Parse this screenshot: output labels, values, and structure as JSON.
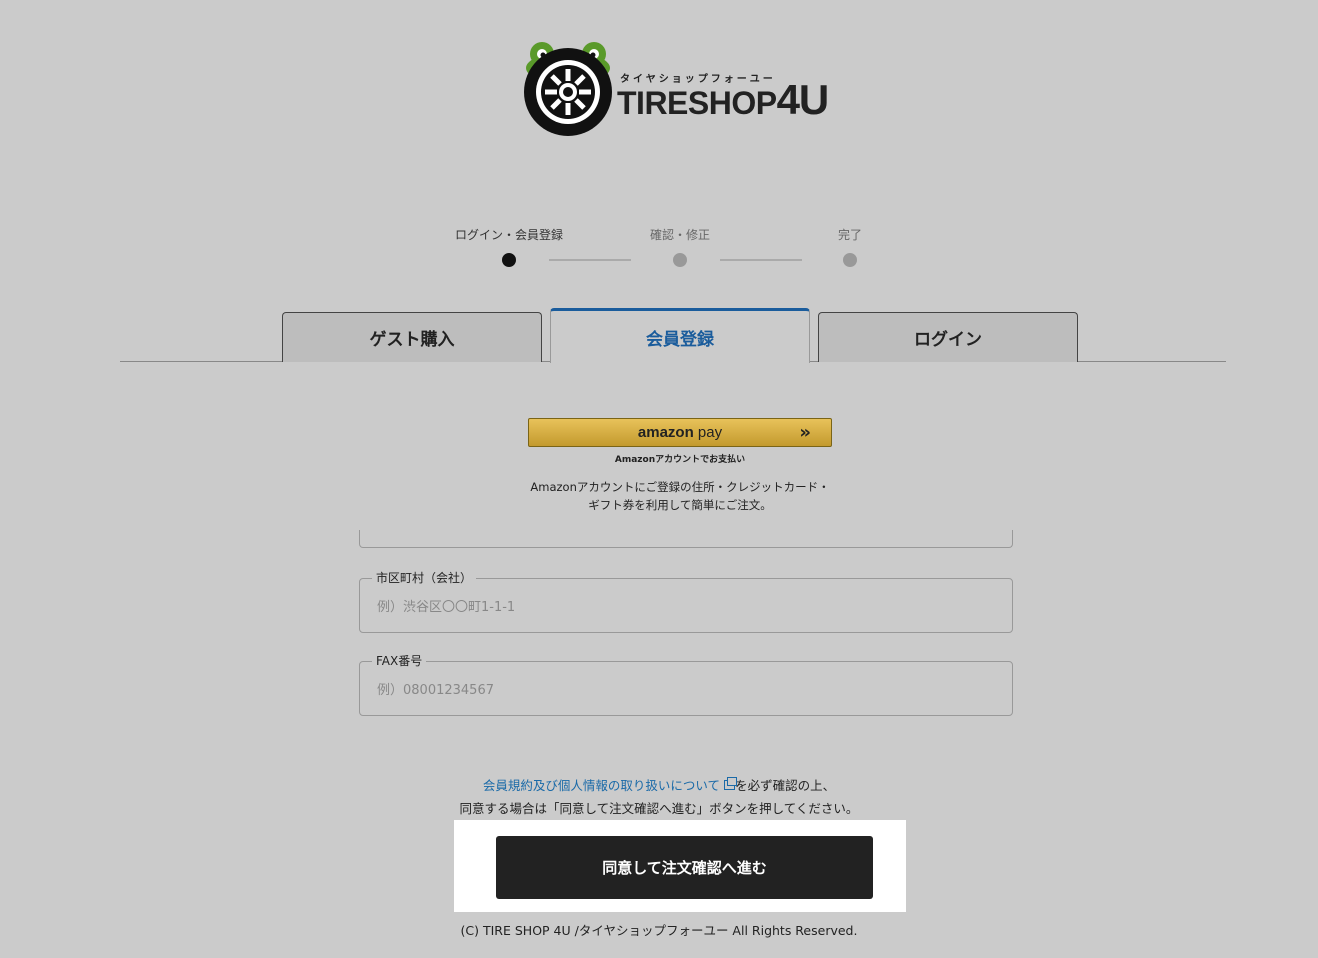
{
  "logo": {
    "kana": "タイヤショップフォーユー",
    "name": "TIRESHOP",
    "suffix": "4U"
  },
  "steps": [
    {
      "label": "ログイン・会員登録",
      "state": "active"
    },
    {
      "label": "確認・修正",
      "state": "inactive"
    },
    {
      "label": "完了",
      "state": "inactive"
    }
  ],
  "tabs": {
    "guest": "ゲスト購入",
    "register": "会員登録",
    "login": "ログイン",
    "active": "register"
  },
  "amazon": {
    "brand": "amazon",
    "pay": "pay",
    "sub": "Amazonアカウントでお支払い",
    "desc": "Amazonアカウントにご登録の住所・クレジットカード・ギフト券を利用して簡単にご注文。"
  },
  "form": {
    "city": {
      "label": "市区町村（会社）",
      "placeholder": "例）渋谷区〇〇町1-1-1"
    },
    "fax": {
      "label": "FAX番号",
      "placeholder": "例）08001234567"
    }
  },
  "terms": {
    "link": "会員規約及び個人情報の取り扱いについて",
    "after_link": "を必ず確認の上、",
    "line2": "同意する場合は「同意して注文確認へ進む」ボタンを押してください。"
  },
  "submit_label": "同意して注文確認へ進む",
  "footer": "(C) TIRE SHOP 4U /タイヤショップフォーユー All Rights Reserved.",
  "colors": {
    "background": "#cbcbcb",
    "accent": "#1a5c9c",
    "logo_green": "#5a9a2a",
    "button_dark": "#222222"
  }
}
